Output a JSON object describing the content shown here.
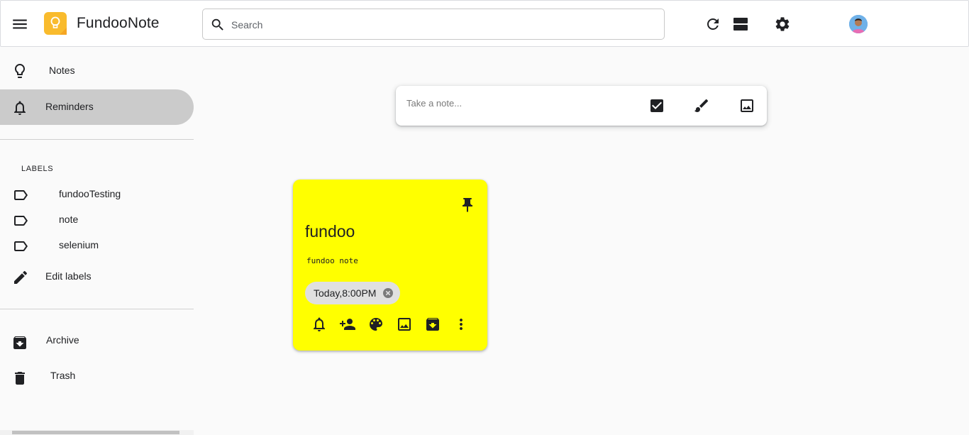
{
  "header": {
    "app_title": "FundooNote",
    "search": {
      "placeholder": "Search",
      "value": ""
    },
    "icons": [
      "menu-icon",
      "keep-logo-icon",
      "search-icon",
      "refresh-icon",
      "list-view-icon",
      "settings-icon",
      "avatar"
    ]
  },
  "sidebar": {
    "nav": [
      {
        "label": "Notes",
        "icon": "lightbulb-icon",
        "active": false
      },
      {
        "label": "Reminders",
        "icon": "bell-icon",
        "active": true
      }
    ],
    "labels_title": "LABELS",
    "labels": [
      {
        "label": "fundooTesting",
        "icon": "label-icon"
      },
      {
        "label": "note",
        "icon": "label-icon"
      },
      {
        "label": "selenium",
        "icon": "label-icon"
      }
    ],
    "edit_labels": "Edit labels",
    "archive": "Archive",
    "trash": "Trash"
  },
  "take_note": {
    "placeholder": "Take a note...",
    "icons": [
      "checkbox-icon",
      "brush-icon",
      "image-icon"
    ]
  },
  "note": {
    "title": "fundoo",
    "body": "fundoo note",
    "reminder": "Today,8:00PM",
    "color": "#ffff00",
    "action_icons": [
      "bell-icon",
      "add-collaborator-icon",
      "palette-icon",
      "image-icon",
      "archive-icon",
      "more-vert-icon"
    ]
  },
  "colors": {
    "active_nav": "#cbcbcb",
    "logo": "#f9bb2d",
    "note": "#ffff00"
  }
}
